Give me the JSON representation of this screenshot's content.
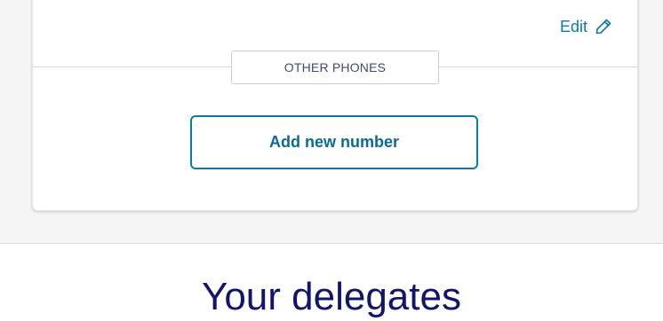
{
  "contact_card": {
    "edit_label": "Edit",
    "edit_icon": "pencil-icon",
    "other_phones_label": "OTHER PHONES",
    "add_button_label": "Add new number"
  },
  "delegates": {
    "heading": "Your delegates"
  },
  "colors": {
    "accent": "#0a7aa6",
    "heading": "#12156b",
    "section_tag_text": "#3d4a7a",
    "page_background": "#f5f5f5"
  }
}
